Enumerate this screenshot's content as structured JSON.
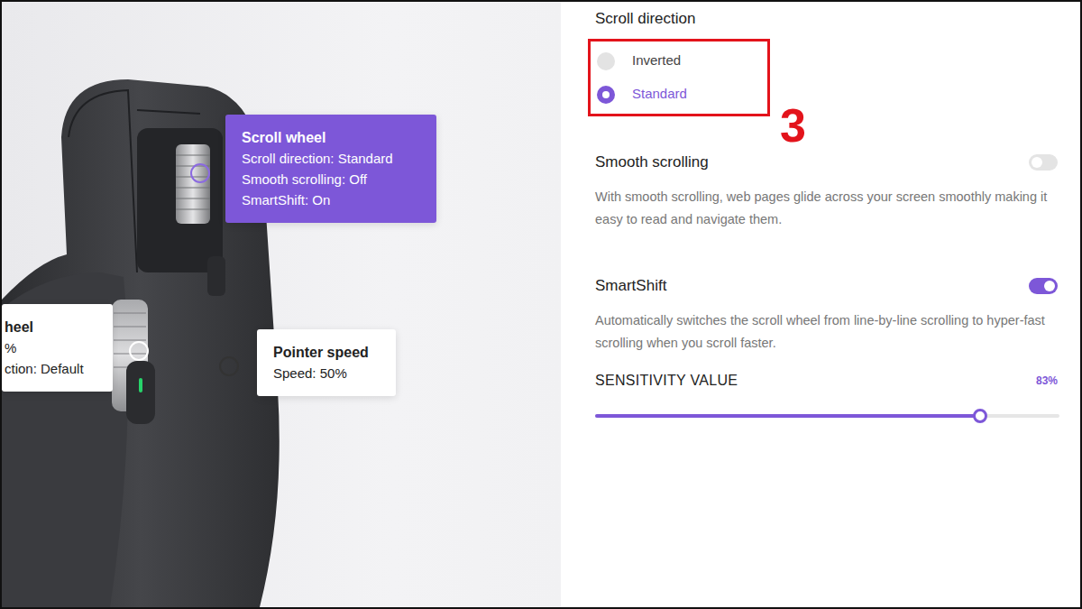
{
  "mouse_callouts": [
    {
      "title": "Scroll wheel",
      "lines": [
        "Scroll direction: Standard",
        "Smooth scrolling: Off",
        "SmartShift: On"
      ],
      "highlighted": true
    },
    {
      "title": "heel",
      "lines": [
        "%",
        "ction: Default"
      ],
      "highlighted": false
    },
    {
      "title": "Pointer speed",
      "lines": [
        "Speed: 50%"
      ],
      "highlighted": false
    }
  ],
  "scroll_direction": {
    "title": "Scroll direction",
    "options": [
      {
        "label": "Inverted",
        "selected": false
      },
      {
        "label": "Standard",
        "selected": true
      }
    ]
  },
  "step_label": "3",
  "smooth_scrolling": {
    "title": "Smooth scrolling",
    "on": false,
    "description": "With smooth scrolling, web pages glide across your screen smoothly making it easy to read and navigate them."
  },
  "smartshift": {
    "title": "SmartShift",
    "on": true,
    "description": "Automatically switches the scroll wheel from line-by-line scrolling to hyper-fast scrolling when you scroll faster."
  },
  "sensitivity": {
    "title": "SENSITIVITY VALUE",
    "reading": "83%",
    "level": 0.83
  }
}
